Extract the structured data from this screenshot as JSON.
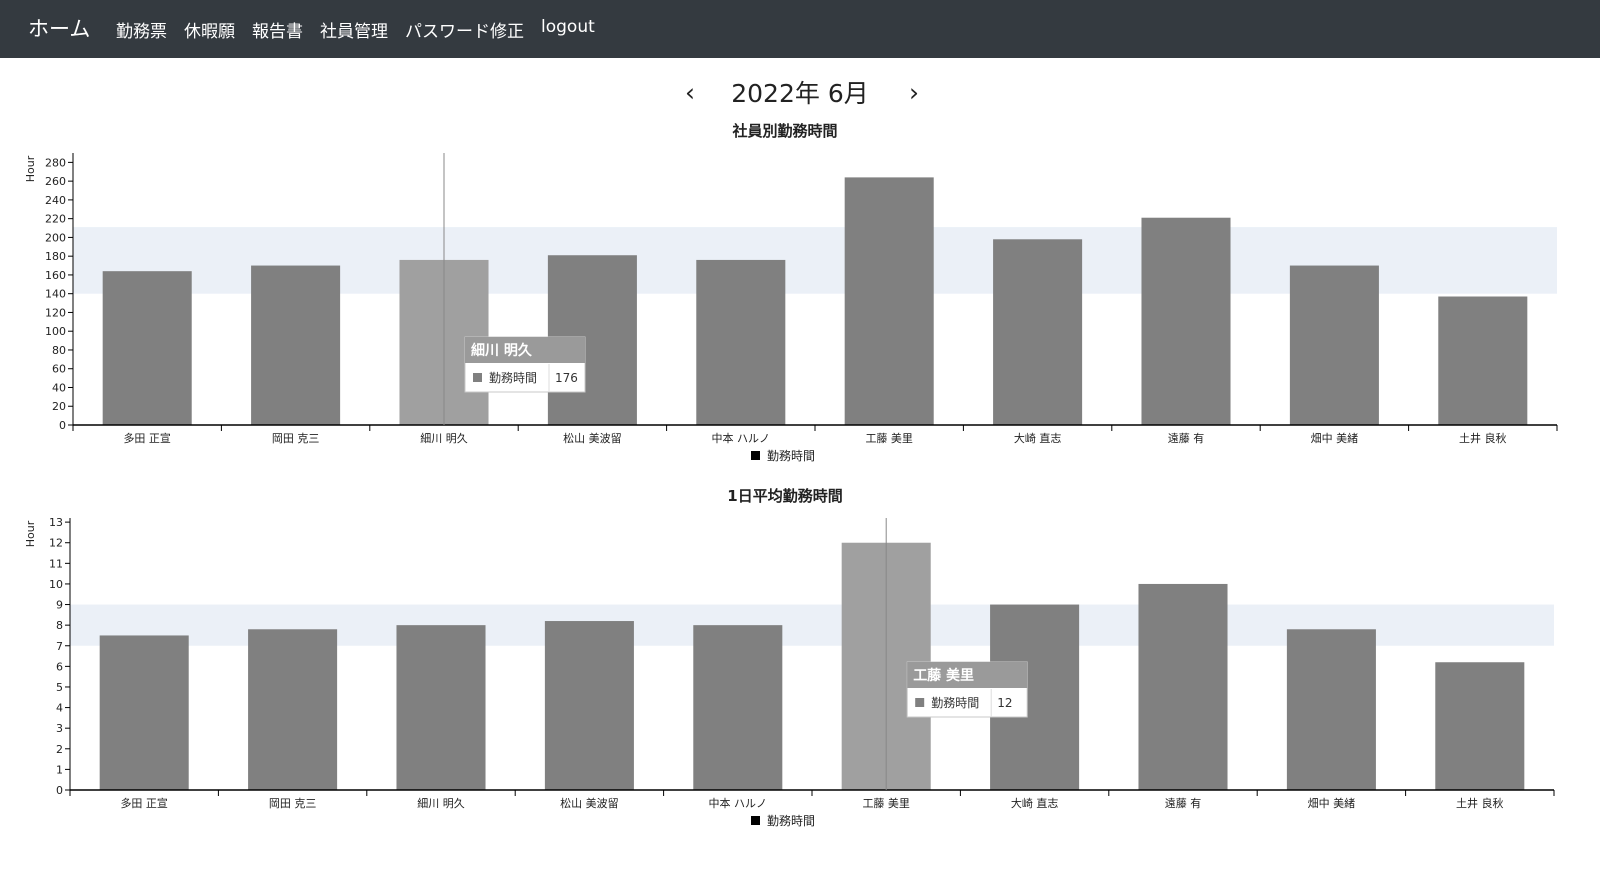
{
  "nav": {
    "brand": "ホーム",
    "links": [
      "勤務票",
      "休暇願",
      "報告書",
      "社員管理",
      "パスワード修正",
      "logout"
    ]
  },
  "month_nav": {
    "prev": "‹",
    "next": "›",
    "label": "2022年 6月"
  },
  "colors": {
    "bar": "#808080",
    "bar_highlight": "#a0a0a0",
    "band": "#ebf0f7",
    "navbar": "#343a40"
  },
  "chart_data": [
    {
      "type": "bar",
      "title": "社員別勤務時間",
      "ylabel": "Hour",
      "xlabel": "",
      "categories": [
        "多田 正宣",
        "岡田 克三",
        "細川 明久",
        "松山 美波留",
        "中本 ハルノ",
        "工藤 美里",
        "大崎 直志",
        "遠藤 有",
        "畑中 美緒",
        "土井 良秋"
      ],
      "series": [
        {
          "name": "勤務時間",
          "values": [
            164,
            170,
            176,
            181,
            176,
            264,
            198,
            221,
            170,
            137
          ]
        }
      ],
      "ylim": [
        0,
        290
      ],
      "yticks": [
        0,
        20,
        40,
        60,
        80,
        100,
        120,
        140,
        160,
        180,
        200,
        220,
        240,
        260,
        280
      ],
      "band": [
        140,
        211
      ],
      "legend": "bottom-center",
      "tooltip": {
        "title": "細川 明久",
        "series": "勤務時間",
        "value": "176"
      },
      "highlight_index": 2
    },
    {
      "type": "bar",
      "title": "1日平均勤務時間",
      "ylabel": "Hour",
      "xlabel": "",
      "categories": [
        "多田 正宣",
        "岡田 克三",
        "細川 明久",
        "松山 美波留",
        "中本 ハルノ",
        "工藤 美里",
        "大崎 直志",
        "遠藤 有",
        "畑中 美緒",
        "土井 良秋"
      ],
      "series": [
        {
          "name": "勤務時間",
          "values": [
            7.5,
            7.8,
            8.0,
            8.2,
            8.0,
            12.0,
            9.0,
            10.0,
            7.8,
            6.2
          ]
        }
      ],
      "ylim": [
        0,
        13.2
      ],
      "yticks": [
        0,
        1,
        2,
        3,
        4,
        5,
        6,
        7,
        8,
        9,
        10,
        11,
        12,
        13
      ],
      "band": [
        7,
        9
      ],
      "legend": "bottom-center",
      "tooltip": {
        "title": "工藤 美里",
        "series": "勤務時間",
        "value": "12"
      },
      "highlight_index": 5
    }
  ]
}
